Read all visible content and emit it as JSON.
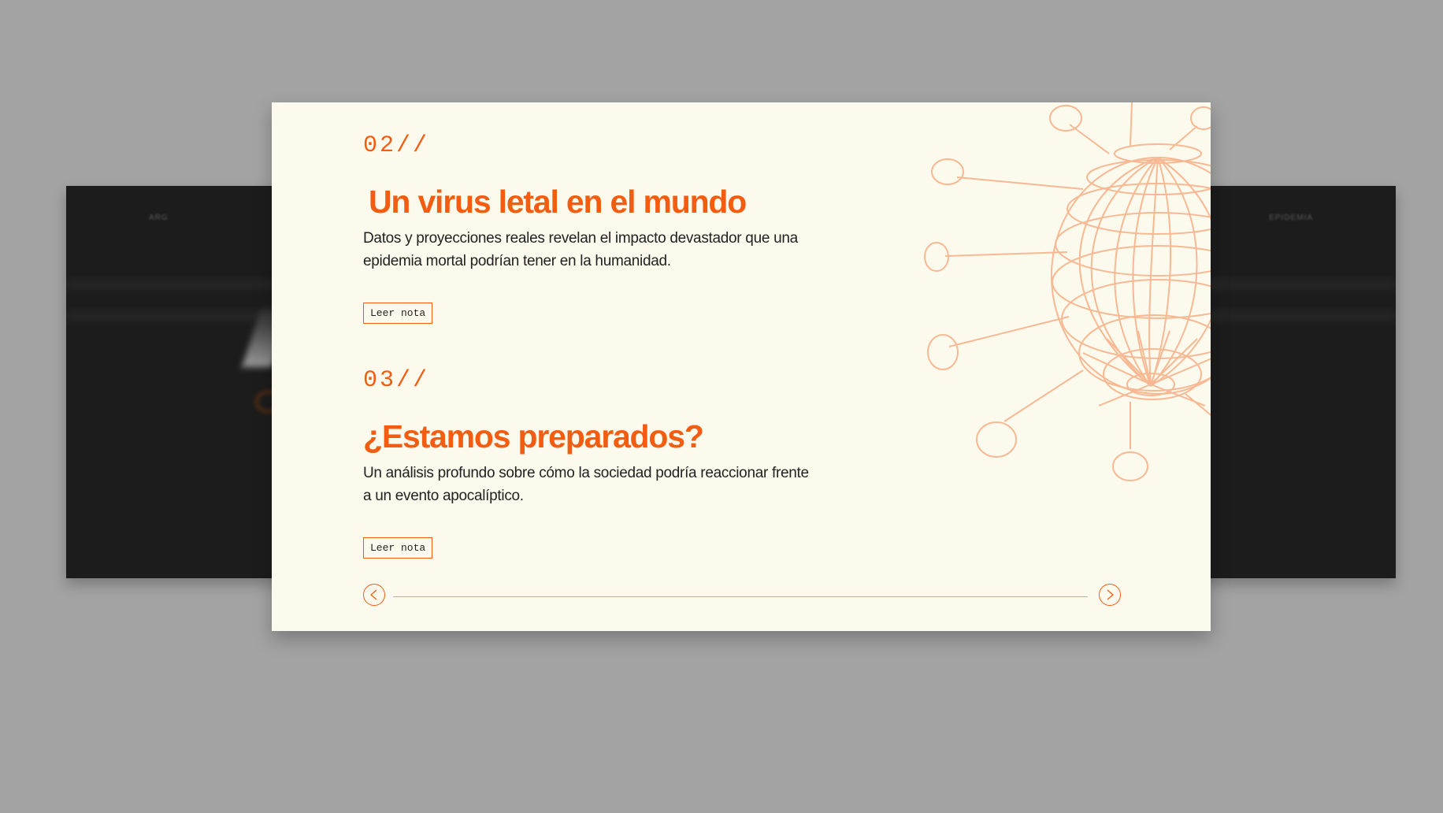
{
  "background_card": {
    "nav_left": "ARG",
    "nav_right": "EPIDEMIA"
  },
  "slides": [
    {
      "number": "02//",
      "title": "Un virus letal en el mundo",
      "description": "Datos y proyecciones reales revelan el impacto devastador que una epidemia mortal podrían tener en la humanidad.",
      "button_label": "Leer nota"
    },
    {
      "number": "03//",
      "title": "¿Estamos preparados?",
      "description": "Un análisis profundo sobre cómo la sociedad podría reaccionar frente a un evento apocalíptico.",
      "button_label": "Leer nota"
    }
  ],
  "colors": {
    "accent": "#f25d12",
    "card_background": "#fcfaec",
    "page_background": "#a3a3a3",
    "dark_card": "#1c1c1c",
    "virus_line": "#f7b893"
  },
  "icons": {
    "prev": "arrow-left-circle-icon",
    "next": "arrow-right-circle-icon",
    "illustration": "virus-wireframe-illustration"
  }
}
